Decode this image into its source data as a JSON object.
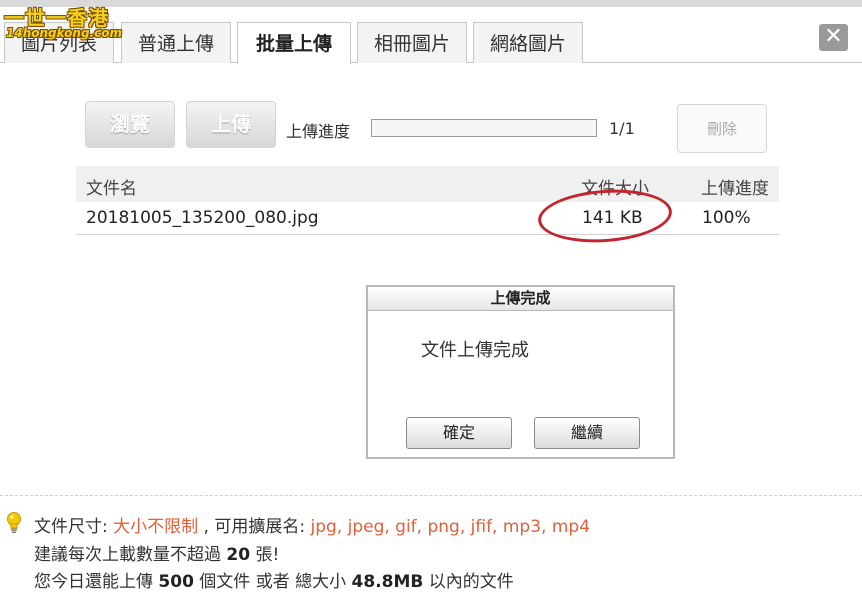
{
  "watermark": {
    "line1": "一世一香港",
    "line2": "14hongkong.com"
  },
  "tabs": [
    {
      "label": "圖片列表"
    },
    {
      "label": "普通上傳"
    },
    {
      "label": "批量上傳",
      "active": true
    },
    {
      "label": "相冊圖片"
    },
    {
      "label": "網絡圖片"
    }
  ],
  "close_label": "✕",
  "toolbar": {
    "browse_label": "瀏覽",
    "upload_label": "上傳",
    "progress_label": "上傳進度",
    "progress_count": "1/1",
    "progress_fraction": 0,
    "delete_label": "刪除"
  },
  "table": {
    "headers": [
      "文件名",
      "文件大小",
      "上傳進度"
    ],
    "rows": [
      {
        "name": "20181005_135200_080.jpg",
        "size": "141 KB",
        "progress": "100%"
      }
    ]
  },
  "dialog": {
    "title": "上傳完成",
    "message": "文件上傳完成",
    "confirm_label": "確定",
    "continue_label": "繼續"
  },
  "info": {
    "size_label": "文件尺寸: ",
    "size_value": "大小不限制",
    "ext_label": " , 可用擴展名: ",
    "ext_value": "jpg, jpeg, gif, png, jfif, mp3, mp4",
    "line2_prefix": "建議每次上載數量不超過 ",
    "line2_number": "20",
    "line2_suffix": " 張!",
    "line3_prefix": "您今日還能上傳 ",
    "line3_count": "500",
    "line3_mid": " 個文件 或者 總大小 ",
    "line3_size": "48.8MB",
    "line3_suffix": " 以內的文件"
  },
  "colors": {
    "highlight": "#e0603a",
    "annotation": "#c4242c",
    "bulb": "#f5c800"
  }
}
